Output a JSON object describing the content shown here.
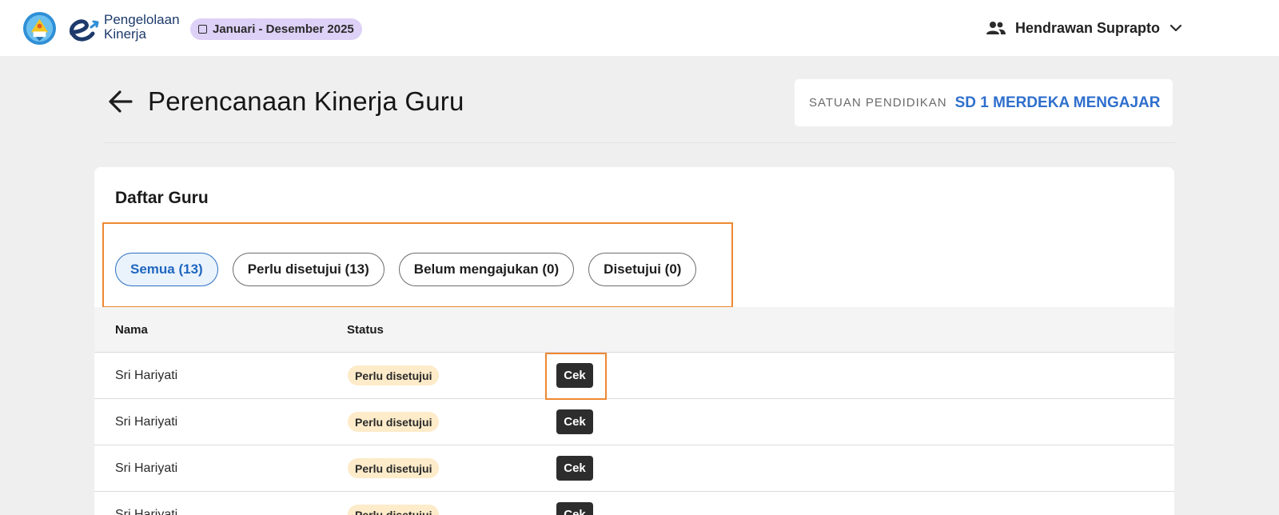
{
  "header": {
    "brand_line1": "Pengelolaan",
    "brand_line2": "Kinerja",
    "period": "Januari - Desember 2025",
    "user_name": "Hendrawan Suprapto"
  },
  "page": {
    "title": "Perencanaan Kinerja Guru",
    "school_label": "SATUAN PENDIDIKAN",
    "school_value": "SD 1 MERDEKA MENGAJAR"
  },
  "card": {
    "title": "Daftar Guru",
    "filters": [
      {
        "label": "Semua (13)",
        "active": true
      },
      {
        "label": "Perlu disetujui (13)",
        "active": false
      },
      {
        "label": "Belum mengajukan (0)",
        "active": false
      },
      {
        "label": "Disetujui (0)",
        "active": false
      }
    ],
    "columns": {
      "name": "Nama",
      "status": "Status"
    },
    "rows": [
      {
        "name": "Sri Hariyati",
        "status": "Perlu disetujui",
        "action": "Cek"
      },
      {
        "name": "Sri Hariyati",
        "status": "Perlu disetujui",
        "action": "Cek"
      },
      {
        "name": "Sri Hariyati",
        "status": "Perlu disetujui",
        "action": "Cek"
      },
      {
        "name": "Sri Hariyati",
        "status": "Perlu disetujui",
        "action": "Cek"
      }
    ]
  },
  "colors": {
    "accent_blue": "#2f6fcd",
    "highlight_orange": "#ee8833",
    "period_chip": "#ddd1f7",
    "status_badge": "#fdebc9",
    "button_dark": "#2d2d2d"
  },
  "icons": [
    "tut-wuri-handayani-emblem-icon",
    "pengelolaan-kinerja-logo-icon",
    "calendar-icon",
    "users-icon",
    "chevron-down-icon",
    "arrow-left-icon"
  ]
}
